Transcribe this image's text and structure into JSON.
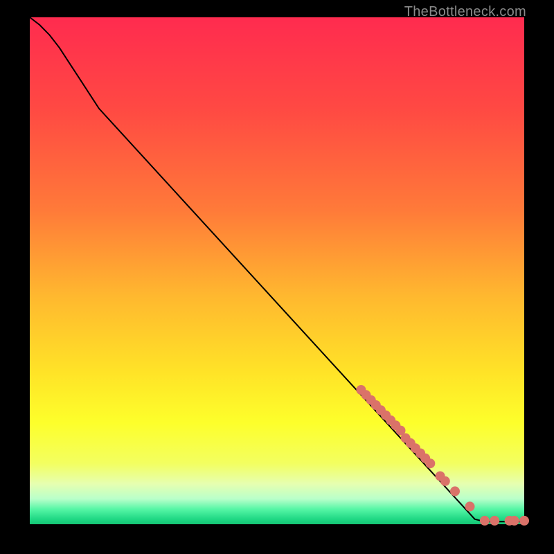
{
  "watermark": "TheBottleneck.com",
  "colors": {
    "black": "#000000",
    "curve": "#000000",
    "dot": "#da7269",
    "gradient_stops": [
      {
        "at": 0,
        "color": "#ff2b4f"
      },
      {
        "at": 18,
        "color": "#ff4943"
      },
      {
        "at": 38,
        "color": "#ff7a39"
      },
      {
        "at": 55,
        "color": "#ffb82f"
      },
      {
        "at": 70,
        "color": "#ffe327"
      },
      {
        "at": 80,
        "color": "#fdff2b"
      },
      {
        "at": 88,
        "color": "#f3ff60"
      },
      {
        "at": 92,
        "color": "#e6ffb0"
      },
      {
        "at": 95,
        "color": "#b9ffca"
      },
      {
        "at": 97,
        "color": "#57f6a6"
      },
      {
        "at": 99,
        "color": "#1fd884"
      },
      {
        "at": 100,
        "color": "#15c574"
      }
    ]
  },
  "chart_data": {
    "type": "line",
    "xlabel": "",
    "ylabel": "",
    "xlim": [
      0,
      100
    ],
    "ylim": [
      0,
      100
    ],
    "title": "",
    "series": [
      {
        "name": "curve",
        "type": "line",
        "x": [
          0,
          2,
          4,
          6,
          8,
          10,
          12,
          14,
          90,
          92,
          94,
          96,
          98,
          100
        ],
        "y": [
          100,
          98.5,
          96.5,
          94.0,
          91.0,
          88.0,
          85.0,
          82.0,
          1.0,
          0.5,
          0.5,
          0.5,
          0.5,
          0.5
        ]
      },
      {
        "name": "dots",
        "type": "scatter",
        "x": [
          67,
          68,
          69,
          70,
          71,
          72,
          73,
          74,
          75,
          76,
          77,
          78,
          79,
          80,
          81,
          83,
          84,
          86,
          89,
          92,
          94,
          97,
          98,
          100
        ],
        "y": [
          26.5,
          25.5,
          24.5,
          23.5,
          22.5,
          21.5,
          20.5,
          19.5,
          18.5,
          17,
          16,
          15,
          14,
          13,
          12,
          9.5,
          8.5,
          6.5,
          3.5,
          0.7,
          0.7,
          0.7,
          0.7,
          0.7
        ]
      }
    ]
  }
}
